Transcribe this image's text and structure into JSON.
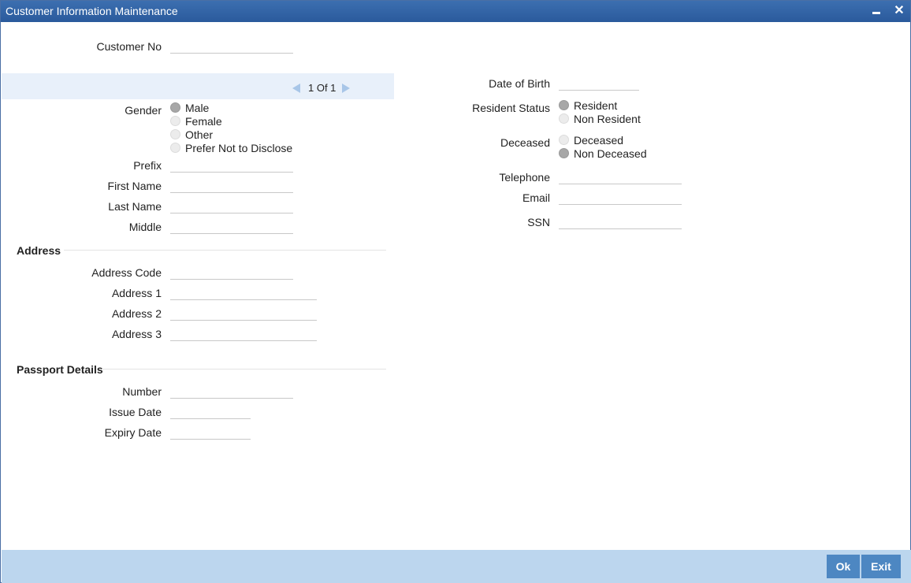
{
  "window": {
    "title": "Customer Information Maintenance"
  },
  "customer_no": {
    "label": "Customer No",
    "value": ""
  },
  "pager": {
    "text": "1 Of 1"
  },
  "gender": {
    "label": "Gender",
    "options": [
      "Male",
      "Female",
      "Other",
      "Prefer Not to Disclose"
    ],
    "selected": "Male"
  },
  "name": {
    "prefix_label": "Prefix",
    "first_name_label": "First Name",
    "last_name_label": "Last Name",
    "middle_label": "Middle"
  },
  "address": {
    "section_title": "Address",
    "code_label": "Address Code",
    "line1_label": "Address 1",
    "line2_label": "Address 2",
    "line3_label": "Address 3"
  },
  "passport": {
    "section_title": "Passport Details",
    "number_label": "Number",
    "issue_date_label": "Issue Date",
    "expiry_date_label": "Expiry Date"
  },
  "right": {
    "dob_label": "Date of Birth",
    "resident_status_label": "Resident Status",
    "resident_options": [
      "Resident",
      "Non Resident"
    ],
    "resident_selected": "Resident",
    "deceased_label": "Deceased",
    "deceased_options": [
      "Deceased",
      "Non Deceased"
    ],
    "deceased_selected": "Non Deceased",
    "telephone_label": "Telephone",
    "email_label": "Email",
    "ssn_label": "SSN"
  },
  "footer": {
    "ok_label": "Ok",
    "exit_label": "Exit"
  }
}
